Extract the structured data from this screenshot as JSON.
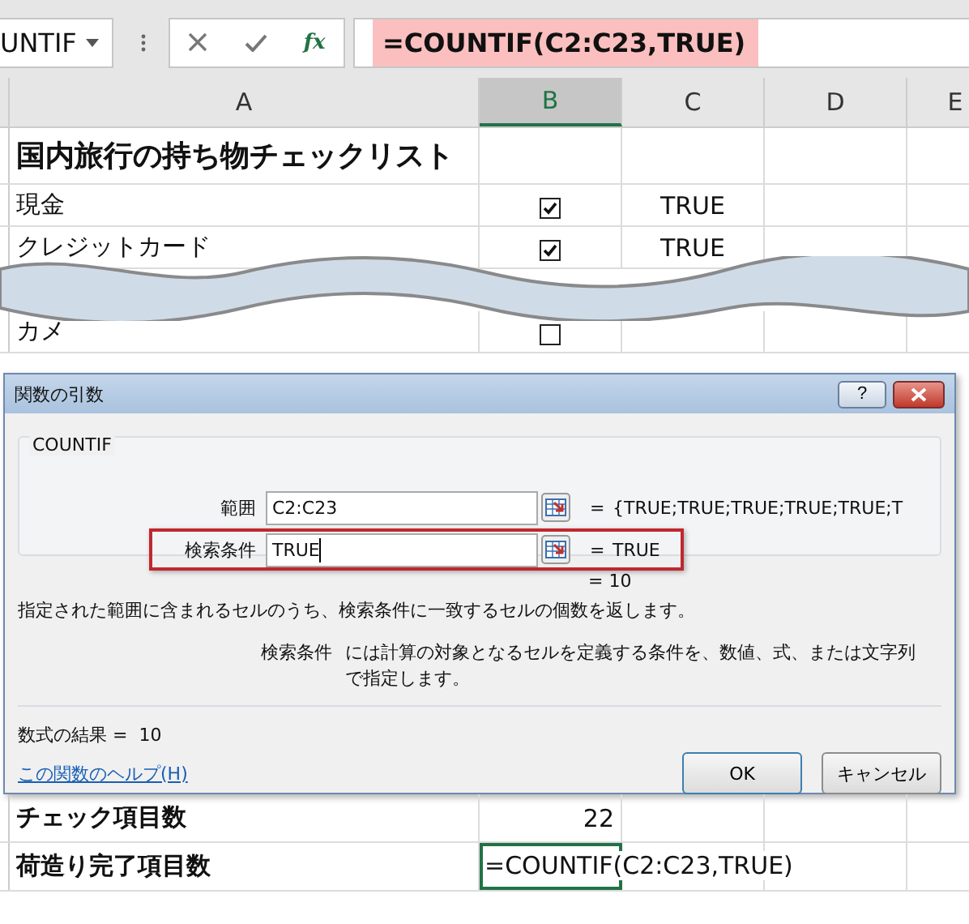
{
  "name_box": {
    "value": "UNTIF"
  },
  "formula_bar": {
    "fx_label": "fx",
    "formula": "=COUNTIF(C2:C23,TRUE)",
    "highlighted": true
  },
  "columns": [
    {
      "label": "A",
      "selected": false
    },
    {
      "label": "B",
      "selected": true
    },
    {
      "label": "C",
      "selected": false
    },
    {
      "label": "D",
      "selected": false
    },
    {
      "label": "E",
      "selected": false
    }
  ],
  "rows": [
    {
      "kind": "title",
      "a": "国内旅行の持ち物チェックリスト"
    },
    {
      "kind": "check",
      "a": "現金",
      "checked": true,
      "c": "TRUE"
    },
    {
      "kind": "check",
      "a": "クレジットカード",
      "checked": true,
      "c": "TRUE"
    },
    {
      "kind": "break"
    },
    {
      "kind": "check",
      "a": "カメ",
      "checked": false
    }
  ],
  "dialog": {
    "title": "関数の引数",
    "help_button": "?",
    "function_name": "COUNTIF",
    "arguments": [
      {
        "label": "範囲",
        "value": "C2:C23",
        "equals": "=",
        "result": "{TRUE;TRUE;TRUE;TRUE;TRUE;T",
        "highlighted": false
      },
      {
        "label": "検索条件",
        "value": "TRUE",
        "equals": "=",
        "result": "TRUE",
        "highlighted": true
      }
    ],
    "result_line": "=  10",
    "description": "指定された範囲に含まれるセルのうち、検索条件に一致するセルの個数を返します。",
    "argument_help": {
      "label": "検索条件",
      "text": "には計算の対象となるセルを定義する条件を、数値、式、または文字列で指定します。"
    },
    "formula_result_label": "数式の結果 =",
    "formula_result": "10",
    "help_link": "この関数のヘルプ(H)",
    "buttons": [
      "OK",
      "キャンセル"
    ]
  },
  "bottom_rows": [
    {
      "a": "チェック項目数",
      "b": "22",
      "active": false
    },
    {
      "a": "荷造り完了項目数",
      "b": "=COUNTIF(C2:C23,TRUE)",
      "active": true
    }
  ]
}
